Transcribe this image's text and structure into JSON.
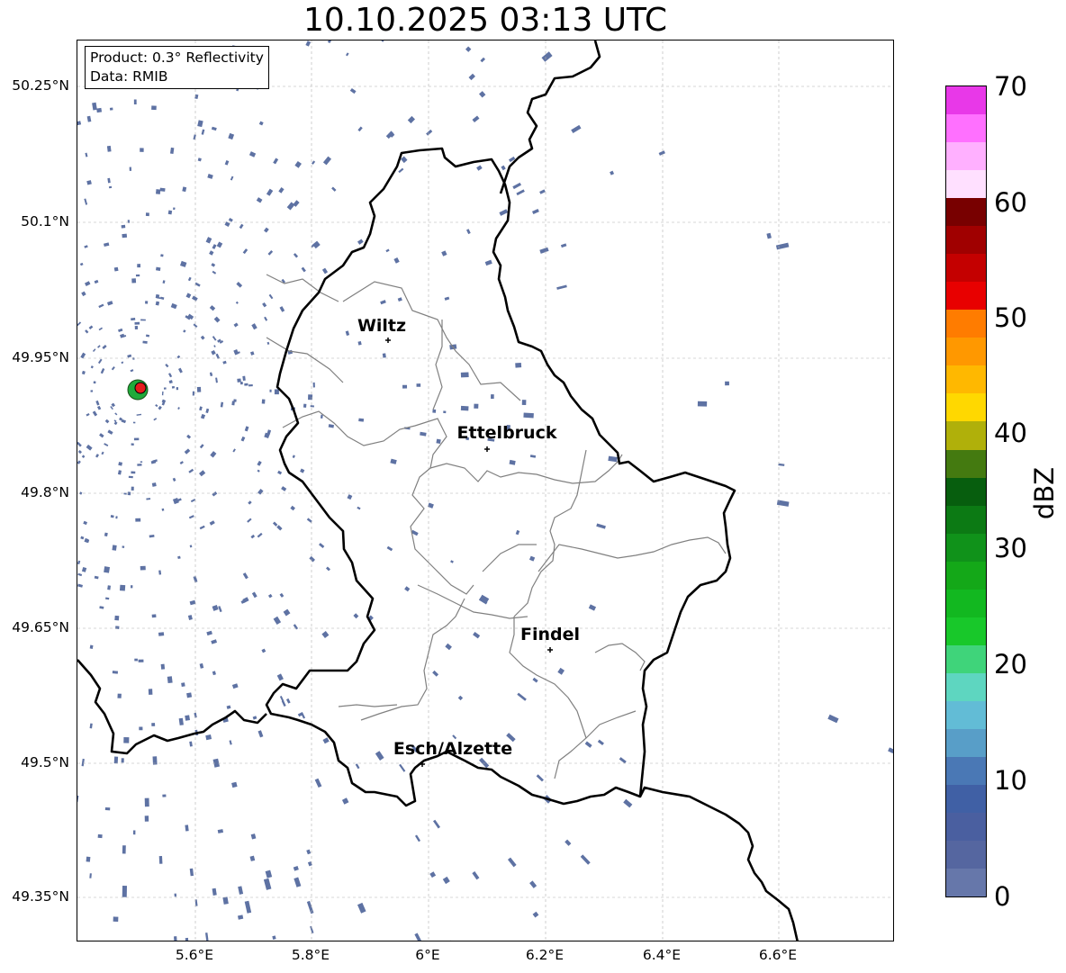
{
  "title": "10.10.2025 03:13 UTC",
  "info": {
    "product": "Product: 0.3° Reflectivity",
    "source": "Data: RMIB"
  },
  "axes": {
    "lat_ticks": [
      "50.25°N",
      "50.1°N",
      "49.95°N",
      "49.8°N",
      "49.65°N",
      "49.5°N",
      "49.35°N"
    ],
    "lon_ticks": [
      "5.6°E",
      "5.8°E",
      "6°E",
      "6.2°E",
      "6.4°E",
      "6.6°E"
    ]
  },
  "cities": [
    {
      "name": "Wiltz"
    },
    {
      "name": "Ettelbruck"
    },
    {
      "name": "Findel"
    },
    {
      "name": "Esch/Alzette"
    }
  ],
  "colorbar": {
    "label": "dBZ",
    "ticks": [
      "0",
      "10",
      "20",
      "30",
      "40",
      "50",
      "60",
      "70"
    ],
    "colors": [
      "#6677aa",
      "#5566a0",
      "#4a5fa0",
      "#4060a5",
      "#4a78b5",
      "#589ec8",
      "#62bcd6",
      "#5ed6c0",
      "#3fd47a",
      "#18c82a",
      "#12b820",
      "#14a818",
      "#10921a",
      "#0c7a14",
      "#075e0e",
      "#447a10",
      "#b0b00a",
      "#ffd800",
      "#ffb800",
      "#ff9800",
      "#ff7c00",
      "#e80000",
      "#c40000",
      "#a00000",
      "#780000",
      "#ffe0ff",
      "#ffb0ff",
      "#ff70ff",
      "#e838e8"
    ]
  },
  "radar_color": "#5e72a3",
  "border_color": "#000000",
  "canton_color": "#808080"
}
